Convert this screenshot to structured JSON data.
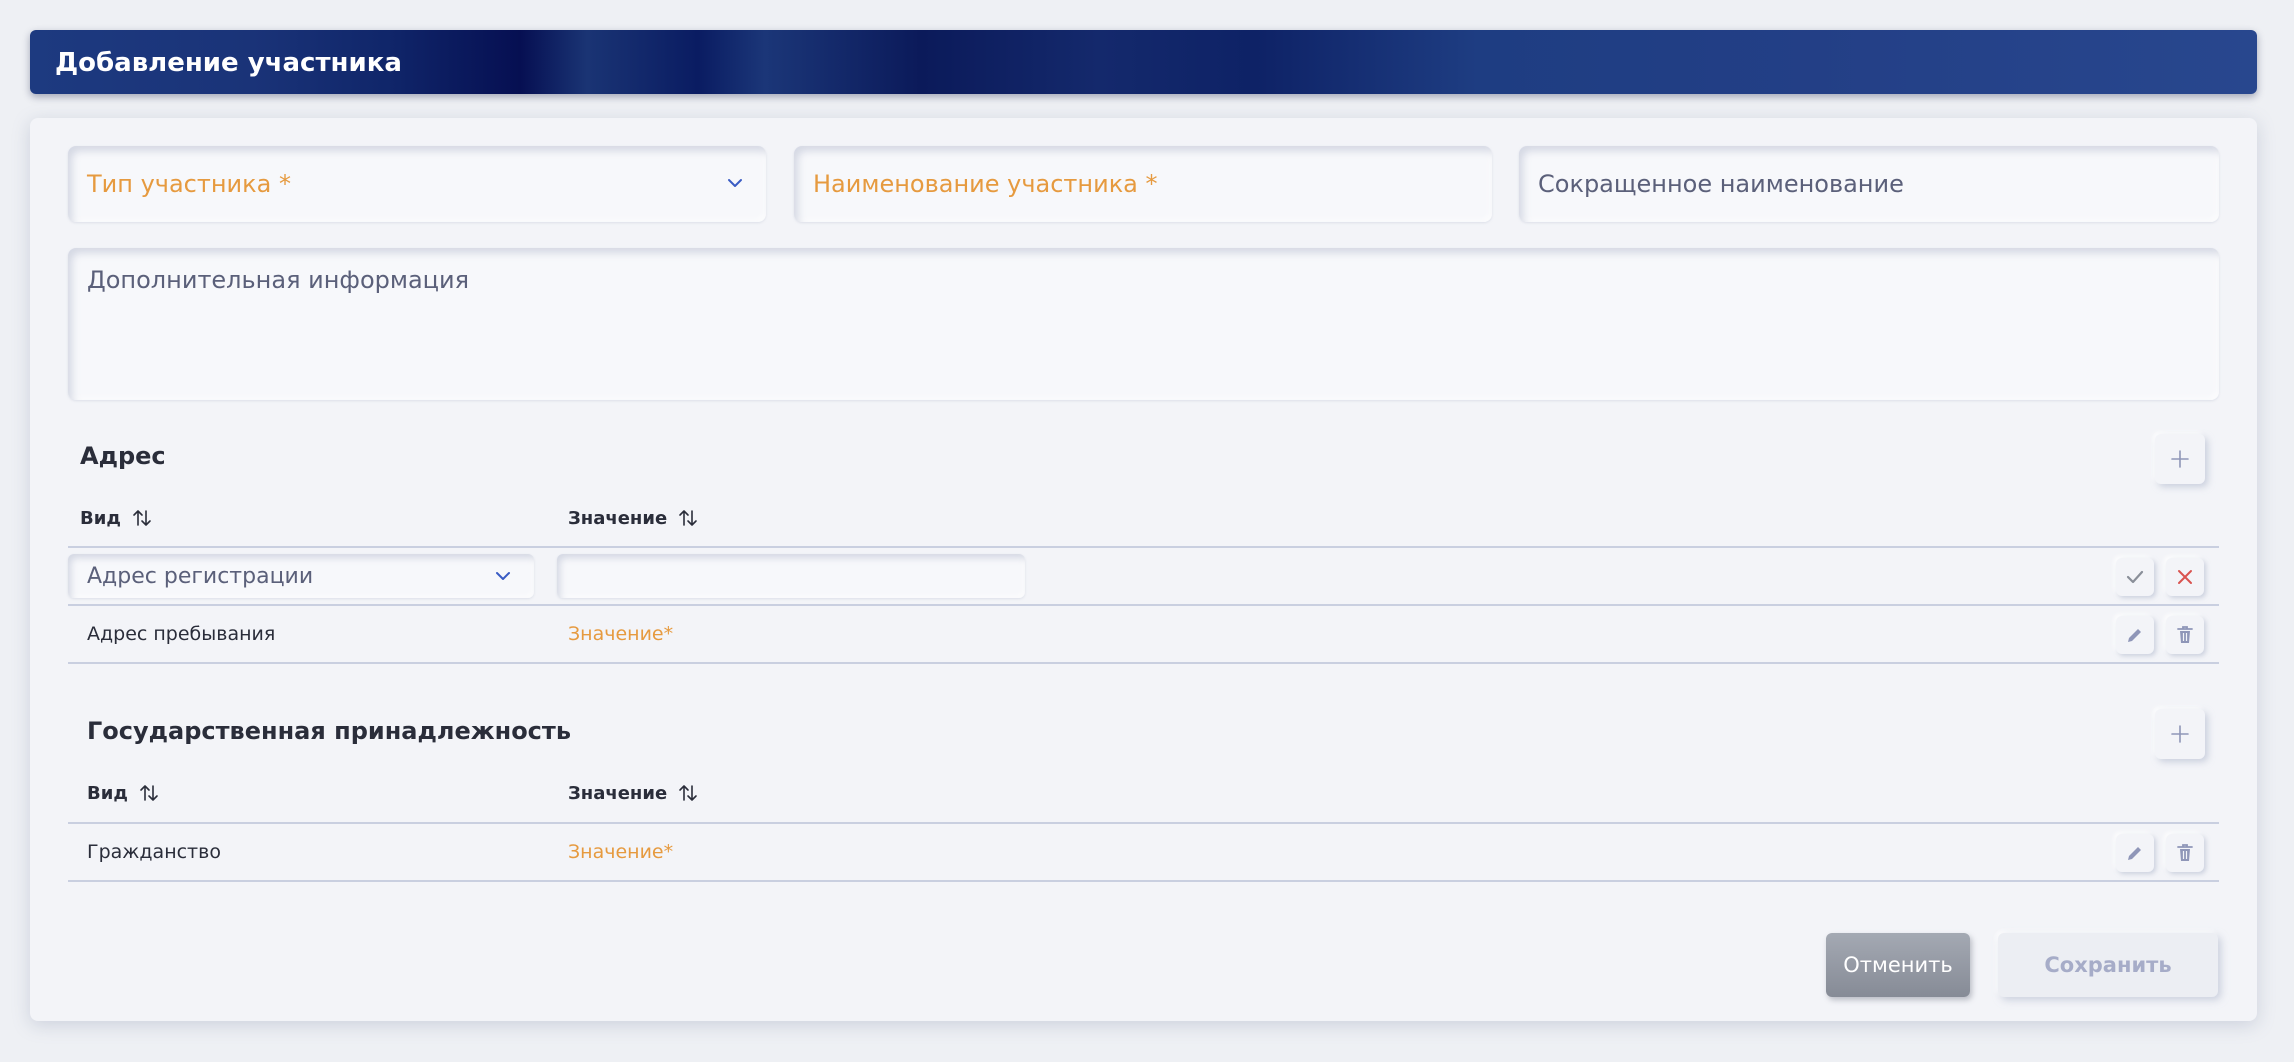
{
  "header": {
    "title": "Добавление участника"
  },
  "form": {
    "participant_type": {
      "label": "Тип участника",
      "required_mark": "*"
    },
    "participant_name": {
      "label": "Наименование участника",
      "required_mark": "*"
    },
    "short_name": {
      "label": "Сокращенное наименование"
    },
    "additional_info": {
      "label": "Дополнительная информация"
    }
  },
  "address": {
    "title": "Адрес",
    "columns": [
      "Вид",
      "Значение"
    ],
    "edit_row": {
      "type_value": "Адрес регистрации",
      "value": ""
    },
    "rows": [
      {
        "type": "Адрес пребывания",
        "value": "Значение*"
      }
    ]
  },
  "citizenship": {
    "title": "Государственная принадлежность",
    "columns": [
      "Вид",
      "Значение"
    ],
    "rows": [
      {
        "type": "Гражданство",
        "value": "Значение*"
      }
    ]
  },
  "actions": {
    "cancel": "Отменить",
    "save": "Сохранить"
  },
  "colors": {
    "accent": "#e69a3f",
    "header": "#1a3378",
    "icon": "#8f96b8",
    "danger": "#d9534f"
  }
}
